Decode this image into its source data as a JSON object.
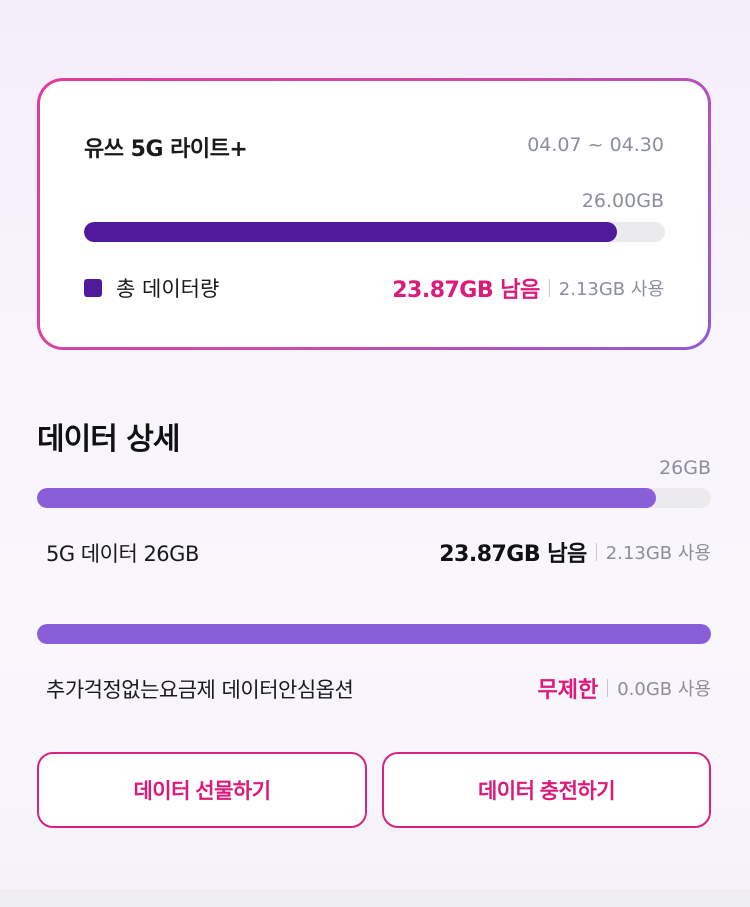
{
  "plan": {
    "name": "유쓰 5G 라이트+",
    "period": "04.07 ~ 04.30",
    "total_capacity": "26.00GB",
    "remaining_fraction": 0.918,
    "legend_label": "총 데이터량",
    "remaining_text": "23.87GB 남음",
    "used_text": "2.13GB 사용",
    "colors": {
      "bar": "#4f1a9b",
      "accent": "#dc1a7a"
    }
  },
  "detail": {
    "title": "데이터 상세",
    "capacity": "26GB",
    "items": [
      {
        "label": "5G 데이터 26GB",
        "remaining_text": "23.87GB 남음",
        "used_text": "2.13GB 사용",
        "fill_fraction": 0.918
      },
      {
        "label": "추가걱정없는요금제 데이터안심옵션",
        "remaining_text": "무제한",
        "used_text": "0.0GB 사용",
        "fill_fraction": 1.0
      }
    ],
    "colors": {
      "bar": "#8a5ed8"
    }
  },
  "actions": {
    "gift_label": "데이터 선물하기",
    "charge_label": "데이터 충전하기"
  }
}
